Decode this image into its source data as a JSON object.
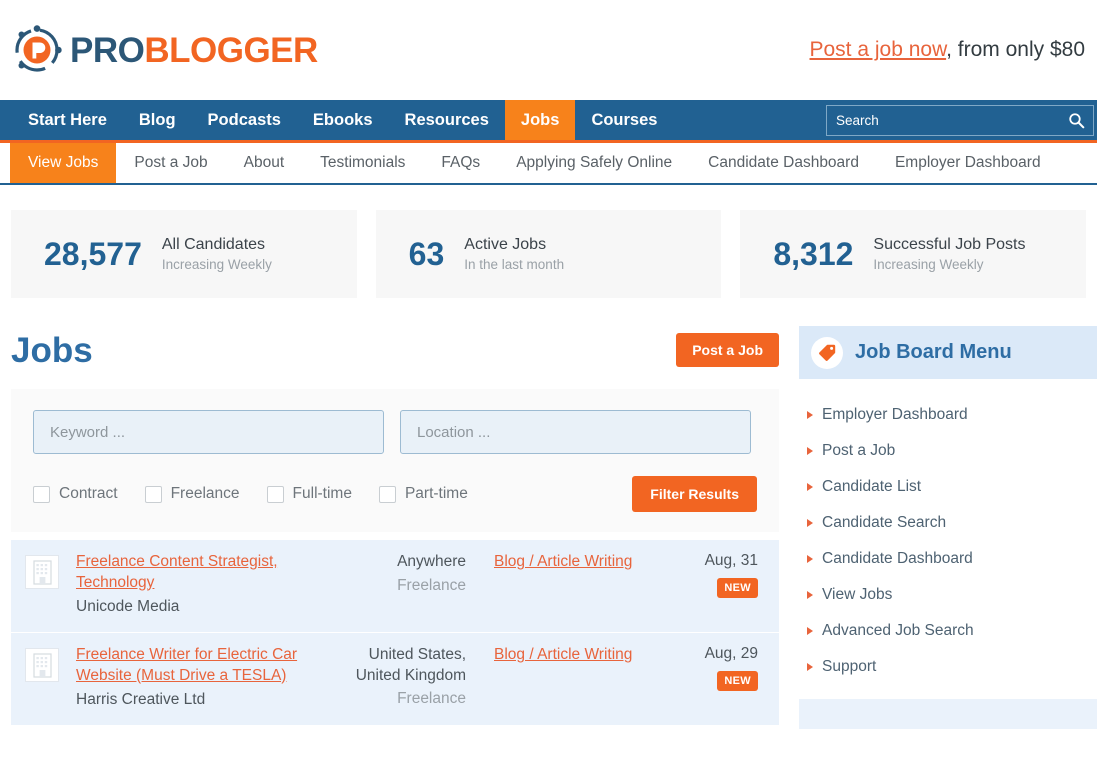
{
  "header": {
    "logo_pro": "PRO",
    "logo_blogger": "BLOGGER",
    "logo_icon": "problogger-circle-p-icon",
    "promo_link": "Post a job now",
    "promo_rest": ", from only $80"
  },
  "main_nav": {
    "items": [
      {
        "label": "Start Here",
        "active": false
      },
      {
        "label": "Blog",
        "active": false
      },
      {
        "label": "Podcasts",
        "active": false
      },
      {
        "label": "Ebooks",
        "active": false
      },
      {
        "label": "Resources",
        "active": false
      },
      {
        "label": "Jobs",
        "active": true
      },
      {
        "label": "Courses",
        "active": false
      }
    ],
    "search_placeholder": "Search",
    "search_icon": "magnifier-icon"
  },
  "sub_nav": {
    "items": [
      {
        "label": "View Jobs",
        "active": true
      },
      {
        "label": "Post a Job",
        "active": false
      },
      {
        "label": "About",
        "active": false
      },
      {
        "label": "Testimonials",
        "active": false
      },
      {
        "label": "FAQs",
        "active": false
      },
      {
        "label": "Applying Safely Online",
        "active": false
      },
      {
        "label": "Candidate Dashboard",
        "active": false
      },
      {
        "label": "Employer Dashboard",
        "active": false
      }
    ]
  },
  "stats": [
    {
      "number": "28,577",
      "label": "All Candidates",
      "sub": "Increasing Weekly"
    },
    {
      "number": "63",
      "label": "Active Jobs",
      "sub": "In the last month"
    },
    {
      "number": "8,312",
      "label": "Successful Job Posts",
      "sub": "Increasing Weekly"
    }
  ],
  "jobs_section": {
    "title": "Jobs",
    "post_button": "Post a Job"
  },
  "filters": {
    "keyword_placeholder": "Keyword ...",
    "location_placeholder": "Location ...",
    "keyword_value": "",
    "location_value": "",
    "checkboxes": [
      {
        "label": "Contract",
        "checked": false
      },
      {
        "label": "Freelance",
        "checked": false
      },
      {
        "label": "Full-time",
        "checked": false
      },
      {
        "label": "Part-time",
        "checked": false
      }
    ],
    "submit_label": "Filter Results"
  },
  "job_list": [
    {
      "logo_icon": "office-building-icon",
      "title": "Freelance Content Strategist, Technology",
      "company": "Unicode Media",
      "location": "Anywhere",
      "job_type": "Freelance",
      "category": "Blog / Article Writing",
      "date": "Aug, 31",
      "badge": "NEW"
    },
    {
      "logo_icon": "office-building-icon",
      "title": "Freelance Writer for Electric Car Website (Must Drive a TESLA)",
      "company": "Harris Creative Ltd",
      "location": "United States, United Kingdom",
      "job_type": "Freelance",
      "category": "Blog / Article Writing",
      "date": "Aug, 29",
      "badge": "NEW"
    }
  ],
  "sidebar": {
    "heading": "Job Board Menu",
    "heading_icon": "orange-tag-icon",
    "items": [
      {
        "label": "Employer Dashboard"
      },
      {
        "label": "Post a Job"
      },
      {
        "label": "Candidate List"
      },
      {
        "label": "Candidate Search"
      },
      {
        "label": "Candidate Dashboard"
      },
      {
        "label": "View Jobs"
      },
      {
        "label": "Advanced Job Search"
      },
      {
        "label": "Support"
      }
    ]
  },
  "colors": {
    "nav_blue": "#216192",
    "accent_orange": "#f26522",
    "link_orange": "#e8643c",
    "title_blue": "#2e6da4",
    "row_blue": "#eaf2fb"
  }
}
